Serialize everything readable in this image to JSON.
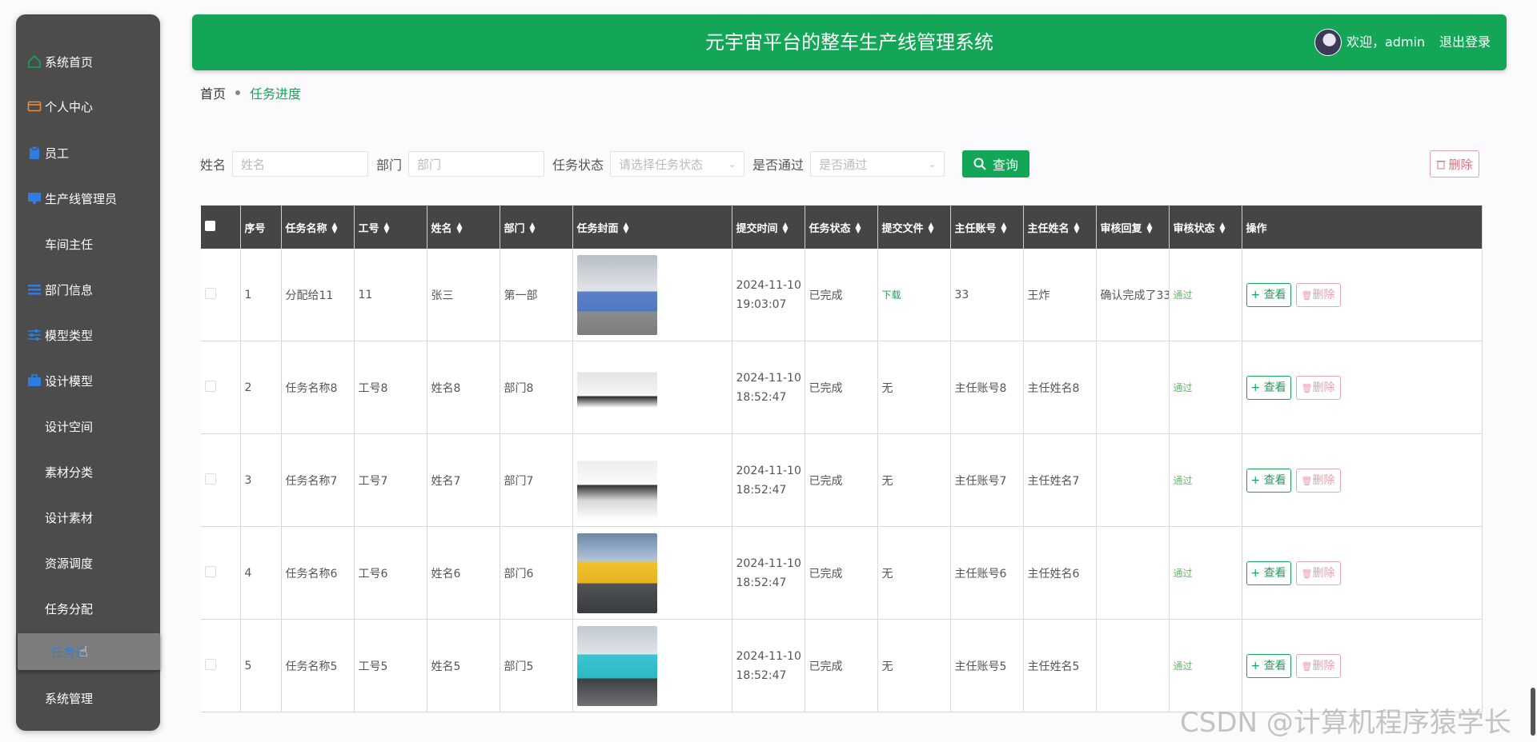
{
  "header": {
    "title": "元宇宙平台的整车生产线管理系统",
    "welcome": "欢迎，admin",
    "logout": "退出登录"
  },
  "sidebar": {
    "items": [
      {
        "label": "系统首页",
        "icon": "home-icon",
        "color": "#13a657"
      },
      {
        "label": "个人中心",
        "icon": "wallet-icon",
        "color": "#f08a3a"
      },
      {
        "label": "员工",
        "icon": "clipboard-icon",
        "color": "#2f7de1"
      },
      {
        "label": "生产线管理员",
        "icon": "monitor-icon",
        "color": "#2f7de1"
      },
      {
        "label": "车间主任",
        "icon": "grid-icon",
        "color": "#2f7de1"
      },
      {
        "label": "部门信息",
        "icon": "list-icon",
        "color": "#2f7de1"
      },
      {
        "label": "模型类型",
        "icon": "sliders-icon",
        "color": "#2f7de1"
      },
      {
        "label": "设计模型",
        "icon": "briefcase-icon",
        "color": "#2f7de1"
      },
      {
        "label": "设计空间",
        "icon": "grid-icon",
        "color": "#2f7de1"
      },
      {
        "label": "素材分类",
        "icon": "grid-icon",
        "color": "#2f7de1"
      },
      {
        "label": "设计素材",
        "icon": "grid-icon",
        "color": "#2f7de1"
      },
      {
        "label": "资源调度",
        "icon": "grid-icon",
        "color": "#2f7de1"
      },
      {
        "label": "任务分配",
        "icon": "grid-icon",
        "color": "#2f7de1"
      },
      {
        "label": "任务进",
        "icon": "grid-icon",
        "color": "#2f7de1"
      },
      {
        "label": "系统管理",
        "icon": "grid-icon",
        "color": "#2f7de1"
      }
    ]
  },
  "breadcrumb": {
    "home": "首页",
    "current": "任务进度"
  },
  "filters": {
    "name_label": "姓名",
    "name_placeholder": "姓名",
    "dept_label": "部门",
    "dept_placeholder": "部门",
    "status_label": "任务状态",
    "status_placeholder": "请选择任务状态",
    "pass_label": "是否通过",
    "pass_placeholder": "是否通过",
    "query": "查询",
    "delete": "删除"
  },
  "table": {
    "columns": [
      "序号",
      "任务名称",
      "工号",
      "姓名",
      "部门",
      "任务封面",
      "提交时间",
      "任务状态",
      "提交文件",
      "主任账号",
      "主任姓名",
      "审核回复",
      "审核状态",
      "操作"
    ],
    "rows": [
      {
        "no": "1",
        "task": "分配给11",
        "emp_no": "11",
        "name": "张三",
        "dept": "第一部",
        "date": "2024-11-10",
        "time": "19:03:07",
        "status": "已完成",
        "file": "下载",
        "dir_acc": "33",
        "dir_name": "王炸",
        "reply": "确认完成了33",
        "audit": "通过"
      },
      {
        "no": "2",
        "task": "任务名称8",
        "emp_no": "工号8",
        "name": "姓名8",
        "dept": "部门8",
        "date": "2024-11-10",
        "time": "18:52:47",
        "status": "已完成",
        "file": "无",
        "dir_acc": "主任账号8",
        "dir_name": "主任姓名8",
        "reply": "",
        "audit": "通过"
      },
      {
        "no": "3",
        "task": "任务名称7",
        "emp_no": "工号7",
        "name": "姓名7",
        "dept": "部门7",
        "date": "2024-11-10",
        "time": "18:52:47",
        "status": "已完成",
        "file": "无",
        "dir_acc": "主任账号7",
        "dir_name": "主任姓名7",
        "reply": "",
        "audit": "通过"
      },
      {
        "no": "4",
        "task": "任务名称6",
        "emp_no": "工号6",
        "name": "姓名6",
        "dept": "部门6",
        "date": "2024-11-10",
        "time": "18:52:47",
        "status": "已完成",
        "file": "无",
        "dir_acc": "主任账号6",
        "dir_name": "主任姓名6",
        "reply": "",
        "audit": "通过"
      },
      {
        "no": "5",
        "task": "任务名称5",
        "emp_no": "工号5",
        "name": "姓名5",
        "dept": "部门5",
        "date": "2024-11-10",
        "time": "18:52:47",
        "status": "已完成",
        "file": "无",
        "dir_acc": "主任账号5",
        "dir_name": "主任姓名5",
        "reply": "",
        "audit": "通过"
      }
    ],
    "view": "查看",
    "del": "删除"
  },
  "watermark": "CSDN @计算机程序猿学长"
}
